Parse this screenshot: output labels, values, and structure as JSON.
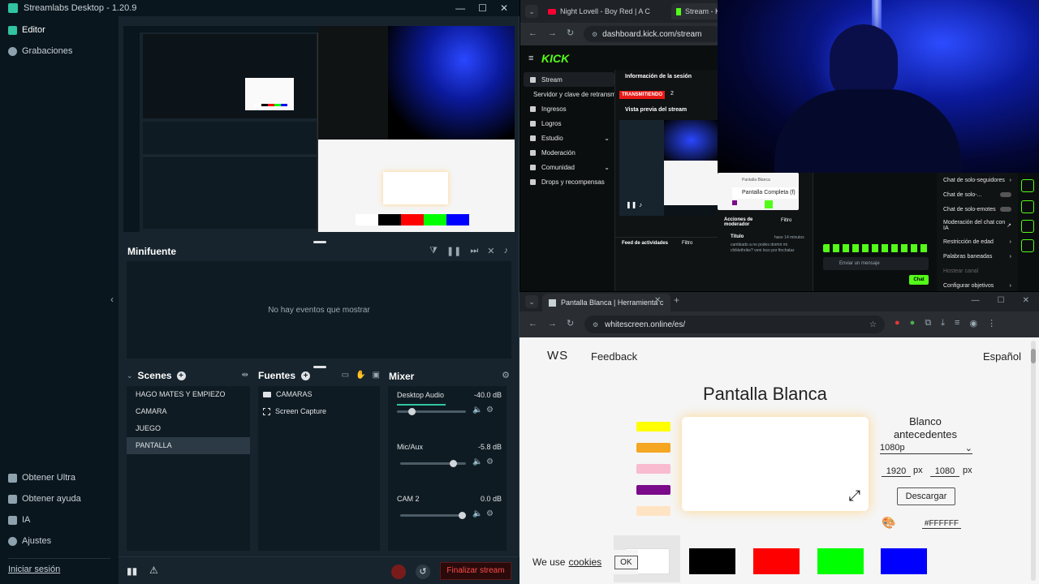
{
  "streamlabs": {
    "window_title": "Streamlabs Desktop - 1.20.9",
    "win_controls": [
      "—",
      "☐",
      "✕"
    ],
    "nav": [
      {
        "label": "Editor",
        "icon": "editor-icon",
        "active": true
      },
      {
        "label": "Grabaciones",
        "icon": "recordings-icon",
        "active": false
      }
    ],
    "bottom_nav": [
      {
        "label": "Obtener Ultra",
        "icon": "ultra-icon"
      },
      {
        "label": "Obtener ayuda",
        "icon": "help-icon"
      },
      {
        "label": "IA",
        "icon": "ai-icon"
      },
      {
        "label": "Ajustes",
        "icon": "gear-icon"
      }
    ],
    "login_link": "Iniciar sesión",
    "minifuente_title": "Minifuente",
    "minifuente_empty": "No hay eventos que mostrar",
    "scenes_title": "Scenes",
    "scenes": [
      "HAGO MATES Y EMPIEZO",
      "CAMARA",
      "JUEGO",
      "PANTALLA"
    ],
    "selected_scene": "PANTALLA",
    "sources_title": "Fuentes",
    "sources": [
      {
        "label": "CAMARAS",
        "icon": "folder-icon"
      },
      {
        "label": "Screen Capture",
        "icon": "screen-capture-icon"
      }
    ],
    "mixer_title": "Mixer",
    "mixer": [
      {
        "name": "Desktop Audio",
        "db": "-40.0 dB",
        "level": 0.18
      },
      {
        "name": "Mic/Aux",
        "db": "-5.8 dB",
        "level": 0.85
      },
      {
        "name": "CAM 2",
        "db": "0.0 dB",
        "level": 1.0
      }
    ],
    "end_stream": "Finalizar stream"
  },
  "kick_browser": {
    "tabs": [
      "Night Lovell - Boy Red | A C",
      "Stream - K"
    ],
    "url": "dashboard.kick.com/stream",
    "logo": "KICK",
    "nav": [
      "Stream",
      "Servidor y clave de retransm",
      "Ingresos",
      "Logros",
      "Estudio",
      "Moderación",
      "Comunidad",
      "Drops y recompensas"
    ],
    "session_info": "Información de la sesión",
    "status_badge": "TRANSMITIENDO",
    "viewer_count": "2",
    "preview_label": "Vista previa del stream",
    "activity_feed": "Feed de actividades",
    "filter": "Filtro",
    "mod_actions": "Acciones de moderador",
    "title_label": "Título",
    "title_time": "hace 14 minutos",
    "title_change": "cambiado a no podes dormir mi chiklethrike? veni loco por finchalaz",
    "popup_title": "Pantalla Blanca",
    "popup_item": "Pantalla Completa (f)"
  },
  "chat_settings": {
    "items": [
      "Chat de solo-seguidores",
      "Chat de solo-...",
      "Chat de solo-emotes",
      "Moderación del chat con IA",
      "Restricción de edad",
      "Palabras baneadas",
      "Hostear canal",
      "Configurar objetivos"
    ],
    "send_placeholder": "Enviar un mensaje",
    "chat_button": "Chat"
  },
  "ws_browser": {
    "tab": "Pantalla Blanca | Herramienta c",
    "url": "whitescreen.online/es/",
    "logo": "WS",
    "feedback": "Feedback",
    "language": "Español",
    "heading": "Pantalla Blanca",
    "side_title": "Blanco antecedentes",
    "resolution": "1080p",
    "width": "1920",
    "height": "1080",
    "unit": "px",
    "download": "Descargar",
    "hex": "#FFFFFF",
    "cookie_text": "We use",
    "cookie_link": "cookies",
    "cookie_ok": "OK",
    "swatches": [
      "#ffff00",
      "#f5a623",
      "#f8bbd0",
      "#7b0b8a",
      "#ffe4c4"
    ],
    "bottom_colors": [
      "#ffffff",
      "#000000",
      "#ff0000",
      "#00ff00",
      "#0000ff"
    ]
  }
}
